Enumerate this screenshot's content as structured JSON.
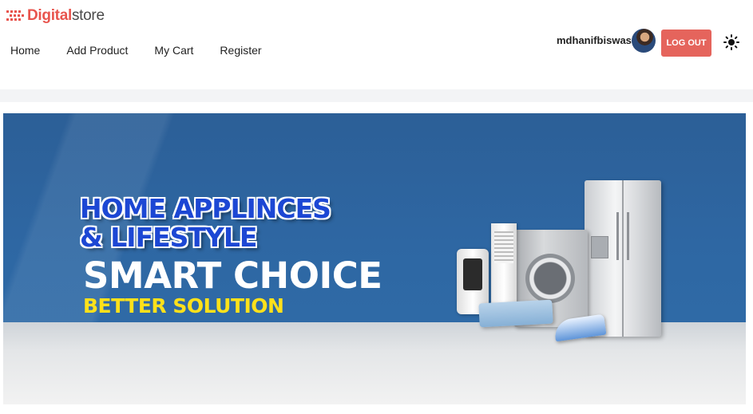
{
  "brand": {
    "part1": "Digital",
    "part2": "store",
    "accent_color": "#e8554e"
  },
  "nav": {
    "items": [
      "Home",
      "Add Product",
      "My Cart",
      "Register"
    ]
  },
  "user": {
    "name": "mdhanifbiswas",
    "logout_label": "LOG OUT",
    "theme_icon": "sun-icon"
  },
  "banner": {
    "line1": "HOME APPLINCES",
    "line2": "& LIFESTYLE",
    "headline": "SMART CHOICE",
    "tagline": "BETTER SOLUTION",
    "colors": {
      "background": "#2e67a3",
      "outline_text": "#1c47d4",
      "tagline": "#ffe11a"
    }
  }
}
